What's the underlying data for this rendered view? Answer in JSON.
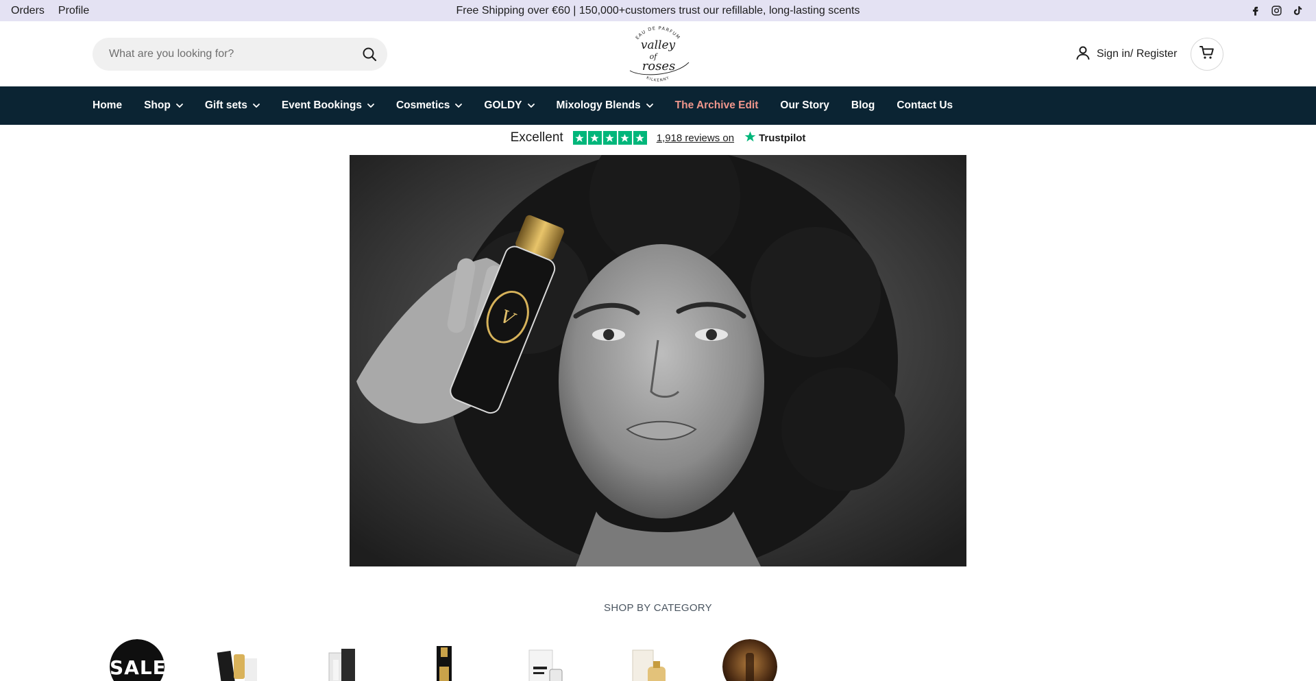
{
  "topbar": {
    "links": [
      "Orders",
      "Profile"
    ],
    "message": "Free Shipping over €60 | 150,000+customers trust our refillable, long-lasting scents",
    "social": [
      "facebook-icon",
      "instagram-icon",
      "tiktok-icon"
    ]
  },
  "header": {
    "search_placeholder": "What are you looking for?",
    "logo": {
      "top_text": "EAU DE PARFUM",
      "script_text": "valley of roses",
      "bottom_text": "KILKENNY"
    },
    "signin_label": "Sign in/ Register",
    "cart_icon": "cart-icon"
  },
  "nav": {
    "items": [
      {
        "label": "Home",
        "dropdown": false
      },
      {
        "label": "Shop",
        "dropdown": true
      },
      {
        "label": "Gift sets",
        "dropdown": true
      },
      {
        "label": "Event Bookings",
        "dropdown": true
      },
      {
        "label": "Cosmetics",
        "dropdown": true
      },
      {
        "label": "GOLDY",
        "dropdown": true
      },
      {
        "label": "Mixology Blends",
        "dropdown": true
      },
      {
        "label": "The Archive Edit",
        "dropdown": false,
        "accent": true
      },
      {
        "label": "Our Story",
        "dropdown": false
      },
      {
        "label": "Blog",
        "dropdown": false
      },
      {
        "label": "Contact Us",
        "dropdown": false
      }
    ]
  },
  "trustpilot": {
    "rating_text": "Excellent",
    "stars": 5,
    "reviews_text": "1,918 reviews on",
    "brand": "Trustpilot"
  },
  "categories": {
    "title": "SHOP BY CATEGORY",
    "sale_label": "SALE"
  },
  "colors": {
    "topbar_bg": "#e4e2f3",
    "nav_bg": "#0b2433",
    "nav_accent": "#f0968c",
    "trustpilot_green": "#00b67a"
  }
}
